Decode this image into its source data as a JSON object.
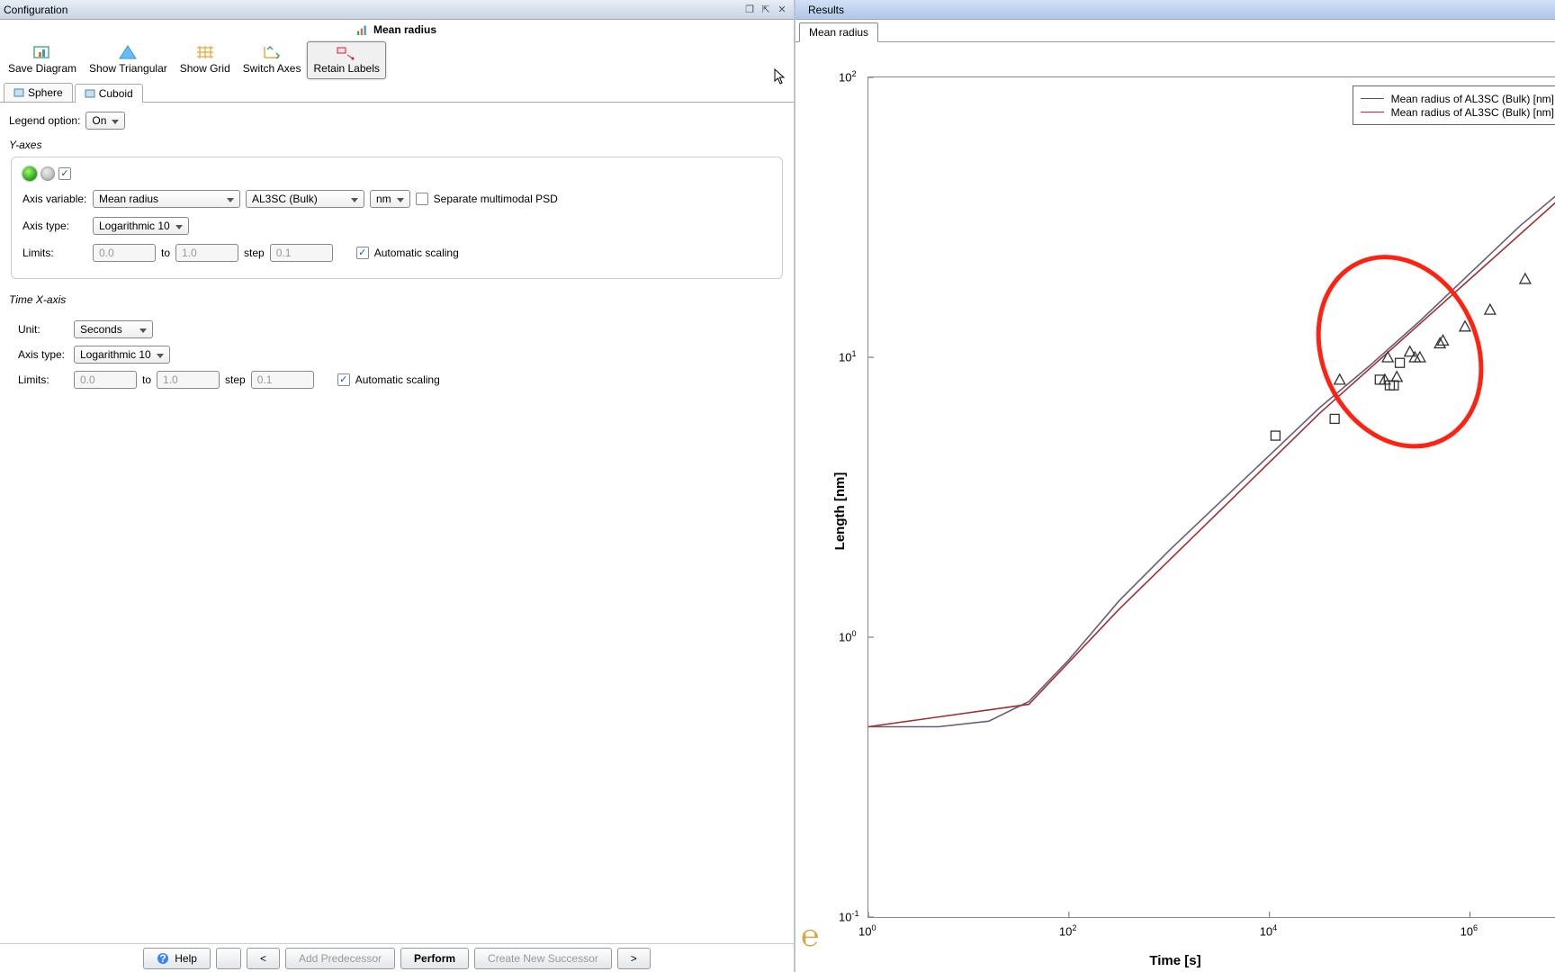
{
  "leftPanel": {
    "title": "Configuration",
    "subtitle": "Mean radius",
    "toolbar": [
      {
        "id": "save-diagram",
        "label": "Save Diagram"
      },
      {
        "id": "show-triangular",
        "label": "Show Triangular"
      },
      {
        "id": "show-grid",
        "label": "Show Grid"
      },
      {
        "id": "switch-axes",
        "label": "Switch Axes"
      },
      {
        "id": "retain-labels",
        "label": "Retain Labels",
        "active": true
      }
    ],
    "tabs": [
      {
        "id": "sphere",
        "label": "Sphere"
      },
      {
        "id": "cuboid",
        "label": "Cuboid",
        "active": true
      }
    ],
    "legendOptionLabel": "Legend option:",
    "legendOptionValue": "On",
    "yAxesLabel": "Y-axes",
    "axisVariableLabel": "Axis variable:",
    "axisVariableValue": "Mean radius",
    "axisVariablePhase": "AL3SC (Bulk)",
    "axisVariableUnit": "nm",
    "separateLabel": "Separate multimodal PSD",
    "axisTypeLabel": "Axis type:",
    "axisTypeValueY": "Logarithmic 10",
    "limitsLabel": "Limits:",
    "limitsFrom": "0.0",
    "toLabel": "to",
    "limitsTo": "1.0",
    "stepLabel": "step",
    "stepValue": "0.1",
    "autoScalingLabel": "Automatic scaling",
    "timeXAxisLabel": "Time X-axis",
    "unitLabel": "Unit:",
    "unitValue": "Seconds",
    "axisTypeValueX": "Logarithmic 10",
    "limitsFromX": "0.0",
    "limitsToX": "1.0",
    "stepValueX": "0.1"
  },
  "bottom": {
    "help": "Help",
    "prev": "<",
    "addPredecessor": "Add Predecessor",
    "perform": "Perform",
    "createSuccessor": "Create New Successor",
    "next": ">"
  },
  "rightPanel": {
    "title": "Results",
    "tabLabel": "Mean radius",
    "xlabel": "Time [s]",
    "ylabel": "Length [nm]",
    "legend": [
      {
        "label": "Mean radius of AL3SC (Bulk) [nm]",
        "color": "#555"
      },
      {
        "label": "Mean radius of AL3SC (Bulk) [nm]",
        "color": "#c23"
      }
    ]
  },
  "chart_data": {
    "type": "line",
    "xscale": "log",
    "yscale": "log",
    "xlabel": "Time [s]",
    "ylabel": "Length [nm]",
    "xrange_exp": [
      0,
      7
    ],
    "yrange_exp": [
      -1,
      2
    ],
    "series": [
      {
        "name": "Mean radius of AL3SC (Bulk) [nm]",
        "color": "#6b5b7a",
        "points": [
          {
            "xexp": 0.0,
            "yexp": -0.32
          },
          {
            "xexp": 0.7,
            "yexp": -0.32
          },
          {
            "xexp": 1.2,
            "yexp": -0.3
          },
          {
            "xexp": 1.6,
            "yexp": -0.23
          },
          {
            "xexp": 2.0,
            "yexp": -0.08
          },
          {
            "xexp": 2.5,
            "yexp": 0.13
          },
          {
            "xexp": 3.0,
            "yexp": 0.31
          },
          {
            "xexp": 3.5,
            "yexp": 0.48
          },
          {
            "xexp": 4.0,
            "yexp": 0.65
          },
          {
            "xexp": 4.5,
            "yexp": 0.82
          },
          {
            "xexp": 5.0,
            "yexp": 0.97
          },
          {
            "xexp": 5.5,
            "yexp": 1.13
          },
          {
            "xexp": 6.0,
            "yexp": 1.3
          },
          {
            "xexp": 6.5,
            "yexp": 1.47
          },
          {
            "xexp": 7.0,
            "yexp": 1.62
          }
        ]
      },
      {
        "name": "Mean radius of AL3SC (Bulk) [nm]",
        "color": "#a03030",
        "points": [
          {
            "xexp": 0.0,
            "yexp": -0.32
          },
          {
            "xexp": 1.6,
            "yexp": -0.24
          },
          {
            "xexp": 2.5,
            "yexp": 0.1
          },
          {
            "xexp": 3.5,
            "yexp": 0.45
          },
          {
            "xexp": 4.5,
            "yexp": 0.8
          },
          {
            "xexp": 5.5,
            "yexp": 1.12
          },
          {
            "xexp": 7.0,
            "yexp": 1.6
          }
        ]
      }
    ],
    "markers_square": [
      {
        "xexp": 4.06,
        "yexp": 0.72
      },
      {
        "xexp": 4.65,
        "yexp": 0.78
      },
      {
        "xexp": 5.1,
        "yexp": 0.92
      },
      {
        "xexp": 5.2,
        "yexp": 0.9
      },
      {
        "xexp": 5.24,
        "yexp": 0.9
      },
      {
        "xexp": 5.3,
        "yexp": 0.98
      }
    ],
    "markers_triangle": [
      {
        "xexp": 4.7,
        "yexp": 0.92
      },
      {
        "xexp": 5.15,
        "yexp": 0.92
      },
      {
        "xexp": 5.18,
        "yexp": 1.0
      },
      {
        "xexp": 5.27,
        "yexp": 0.93
      },
      {
        "xexp": 5.4,
        "yexp": 1.02
      },
      {
        "xexp": 5.45,
        "yexp": 1.0
      },
      {
        "xexp": 5.5,
        "yexp": 1.0
      },
      {
        "xexp": 5.7,
        "yexp": 1.05
      },
      {
        "xexp": 5.73,
        "yexp": 1.06
      },
      {
        "xexp": 5.95,
        "yexp": 1.11
      },
      {
        "xexp": 6.2,
        "yexp": 1.17
      },
      {
        "xexp": 6.55,
        "yexp": 1.28
      }
    ],
    "annotation": {
      "shape": "ellipse",
      "color": "#f21",
      "cx_exp": 5.3,
      "cy_exp": 1.02,
      "rx_exp": 1.4,
      "ry_exp": 0.35,
      "rotate_deg": -25
    }
  }
}
